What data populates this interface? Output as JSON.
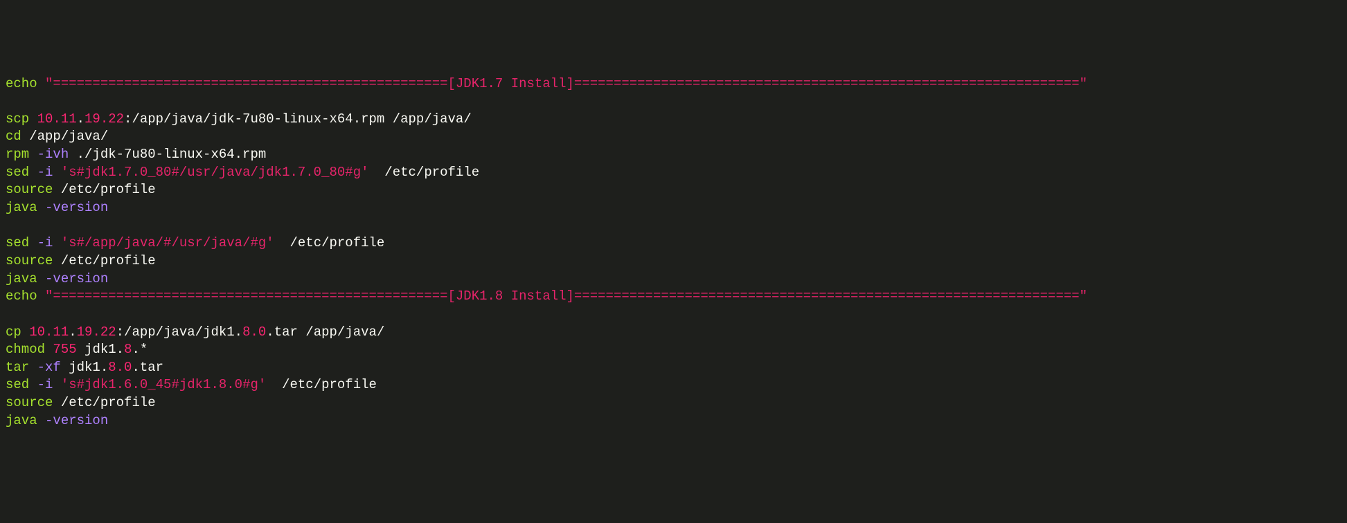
{
  "code": {
    "line1": {
      "t1": "echo",
      "t2": " \"==================================================[JDK1.7 Install]================================================================\""
    },
    "line2": "",
    "line3": {
      "t1": "scp ",
      "t2": "10.11",
      "t3": ".",
      "t4": "19.22",
      "t5": ":/app/java/jdk-7u80-linux-x64.rpm /app/java/"
    },
    "line4": {
      "t1": "cd",
      "t2": " /app/java/"
    },
    "line5": {
      "t1": "rpm ",
      "t2": "-ivh",
      "t3": " ./jdk-7u80-linux-x64.rpm"
    },
    "line6": {
      "t1": "sed ",
      "t2": "-i",
      "t3": " 's#jdk1.7.0_80#/usr/java/jdk1.7.0_80#g'",
      "t4": "  /etc/profile"
    },
    "line7": {
      "t1": "source",
      "t2": " /etc/profile"
    },
    "line8": {
      "t1": "java ",
      "t2": "-version"
    },
    "line9": "",
    "line10": {
      "t1": "sed ",
      "t2": "-i",
      "t3": " 's#/app/java/#/usr/java/#g'",
      "t4": "  /etc/profile"
    },
    "line11": {
      "t1": "source",
      "t2": " /etc/profile"
    },
    "line12": {
      "t1": "java ",
      "t2": "-version"
    },
    "line13": {
      "t1": "echo",
      "t2": " \"==================================================[JDK1.8 Install]================================================================\""
    },
    "line14": "",
    "line15": {
      "t1": "cp ",
      "t2": "10.11",
      "t3": ".",
      "t4": "19.22",
      "t5": ":/app/java/jdk1.",
      "t6": "8.0",
      "t7": ".tar /app/java/"
    },
    "line16": {
      "t1": "chmod ",
      "t2": "755",
      "t3": " jdk1.",
      "t4": "8",
      "t5": ".*"
    },
    "line17": {
      "t1": "tar ",
      "t2": "-xf",
      "t3": " jdk1.",
      "t4": "8.0",
      "t5": ".tar"
    },
    "line18": {
      "t1": "sed ",
      "t2": "-i",
      "t3": " 's#jdk1.6.0_45#jdk1.8.0#g'",
      "t4": "  /etc/profile"
    },
    "line19": {
      "t1": "source",
      "t2": " /etc/profile"
    },
    "line20": {
      "t1": "java ",
      "t2": "-version"
    }
  }
}
